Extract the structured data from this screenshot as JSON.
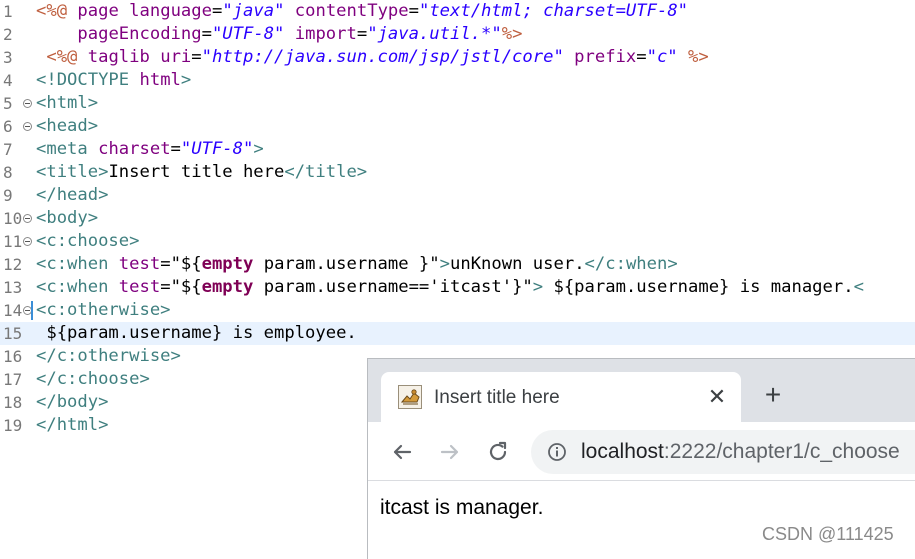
{
  "editor": {
    "lines": [
      {
        "num": "1",
        "fold": false
      },
      {
        "num": "2",
        "fold": false
      },
      {
        "num": "3",
        "fold": false
      },
      {
        "num": "4",
        "fold": false
      },
      {
        "num": "5",
        "fold": true
      },
      {
        "num": "6",
        "fold": true
      },
      {
        "num": "7",
        "fold": false
      },
      {
        "num": "8",
        "fold": false
      },
      {
        "num": "9",
        "fold": false
      },
      {
        "num": "10",
        "fold": true
      },
      {
        "num": "11",
        "fold": true
      },
      {
        "num": "12",
        "fold": false
      },
      {
        "num": "13",
        "fold": false
      },
      {
        "num": "14",
        "fold": true
      },
      {
        "num": "15",
        "fold": false
      },
      {
        "num": "16",
        "fold": false
      },
      {
        "num": "17",
        "fold": false
      },
      {
        "num": "18",
        "fold": false
      },
      {
        "num": "19",
        "fold": false
      }
    ],
    "code": {
      "l1": [
        "<%@",
        "page",
        "language",
        "=",
        "\"java\"",
        "contentType",
        "=",
        "\"text/html; charset=UTF-8\""
      ],
      "l2": [
        "pageEncoding",
        "=",
        "\"UTF-8\"",
        "import",
        "=",
        "\"java.util.*\"",
        "%>"
      ],
      "l3": [
        "<%@",
        "taglib",
        "uri",
        "=",
        "\"http://java.sun.com/jsp/jstl/core\"",
        "prefix",
        "=",
        "\"c\"",
        "%>"
      ],
      "l4": [
        "<!DOCTYPE",
        "html",
        ">"
      ],
      "l5": [
        "<html>"
      ],
      "l6": [
        "<head>"
      ],
      "l7": [
        "<meta",
        "charset",
        "=",
        "\"UTF-8\"",
        ">"
      ],
      "l8": [
        "<title>",
        "Insert title here",
        "</title>"
      ],
      "l9": [
        "</head>"
      ],
      "l10": [
        "<body>"
      ],
      "l11": [
        "<c:choose>"
      ],
      "l12": [
        "<c:when",
        "test",
        "=",
        "\"${",
        "empty",
        "param.username }",
        "\"",
        ">",
        "unKnown user.",
        "</c:when>"
      ],
      "l13": [
        "<c:when",
        "test",
        "=",
        "\"${",
        "empty",
        "param.username=='itcast'",
        "}\"",
        ">",
        " ${param.username} is manager.",
        "<"
      ],
      "l14": [
        "<c:otherwise>"
      ],
      "l15": [
        " ${param.username} is employee."
      ],
      "l16": [
        "</c:otherwise>"
      ],
      "l17": [
        "</c:choose>"
      ],
      "l18": [
        "</body>"
      ],
      "l19": [
        "</html>"
      ]
    }
  },
  "browser": {
    "tab_title": "Insert title here",
    "tab_close": "✕",
    "new_tab": "+",
    "url_host": "localhost",
    "url_path": ":2222/chapter1/c_choose",
    "page_text": "itcast is manager."
  },
  "watermark": "CSDN @111425",
  "colors": {
    "tag": "#3f7f7f",
    "directive": "#bf5f3f",
    "attribute": "#7f007f",
    "string": "#2a00ff",
    "keyword": "#7f0055",
    "current_line": "#e8f2fe",
    "tabstrip": "#dee1e6"
  }
}
